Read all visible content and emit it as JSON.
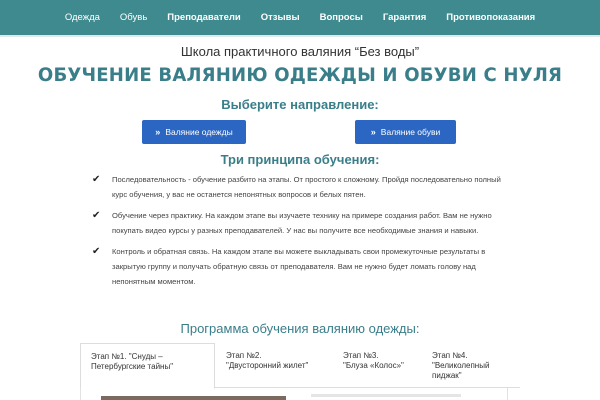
{
  "nav": {
    "items": [
      {
        "label": "Одежда"
      },
      {
        "label": "Обувь"
      },
      {
        "label": "Преподаватели"
      },
      {
        "label": "Отзывы"
      },
      {
        "label": "Вопросы"
      },
      {
        "label": "Гарантия"
      },
      {
        "label": "Противопоказания"
      }
    ]
  },
  "hero": {
    "school_name": "Школа практичного валяния “Без воды”",
    "headline": "ОБУЧЕНИЕ ВАЛЯНИЮ ОДЕЖДЫ И ОБУВИ С НУЛЯ",
    "choose_label": "Выберите направление:",
    "btn_clothes": "Валяние одежды",
    "btn_shoes": "Валяние обуви",
    "btn_icon": "»"
  },
  "principles": {
    "title": "Три принципа обучения:",
    "items": [
      {
        "text": "Последовательность - обучение разбито на этапы. От простого к сложному. Пройдя последовательно полный курс обучения, у вас не останется непонятных вопросов и белых пятен."
      },
      {
        "text": "Обучение через практику. На каждом этапе вы изучаете технику на примере создания работ. Вам не нужно покупать видео курсы у разных преподавателей. У нас вы получите все необходимые знания и навыки."
      },
      {
        "text": "Контроль и обратная связь. На каждом этапе вы можете выкладывать свои промежуточные результаты в закрытую группу и получать обратную связь от преподавателя. Вам не нужно будет ломать голову над непонятным моментом."
      }
    ],
    "check_icon": "✔"
  },
  "program": {
    "title": "Программа обучения валянию одежды:",
    "tabs": [
      {
        "line1": "Этап №1. \"Снуды –",
        "line2": "Петербургские тайны\""
      },
      {
        "line1": "Этап №2.",
        "line2": "\"Двусторонний жилет\""
      },
      {
        "line1": "Этап №3.",
        "line2": "\"Блуза «Колос»\""
      },
      {
        "line1": "Этап №4. \"Великолепный",
        "line2": "пиджак\""
      }
    ]
  },
  "colors": {
    "nav_bg": "#3f8a8f",
    "accent_teal": "#3a7e8a",
    "button_blue": "#2b66c2"
  }
}
